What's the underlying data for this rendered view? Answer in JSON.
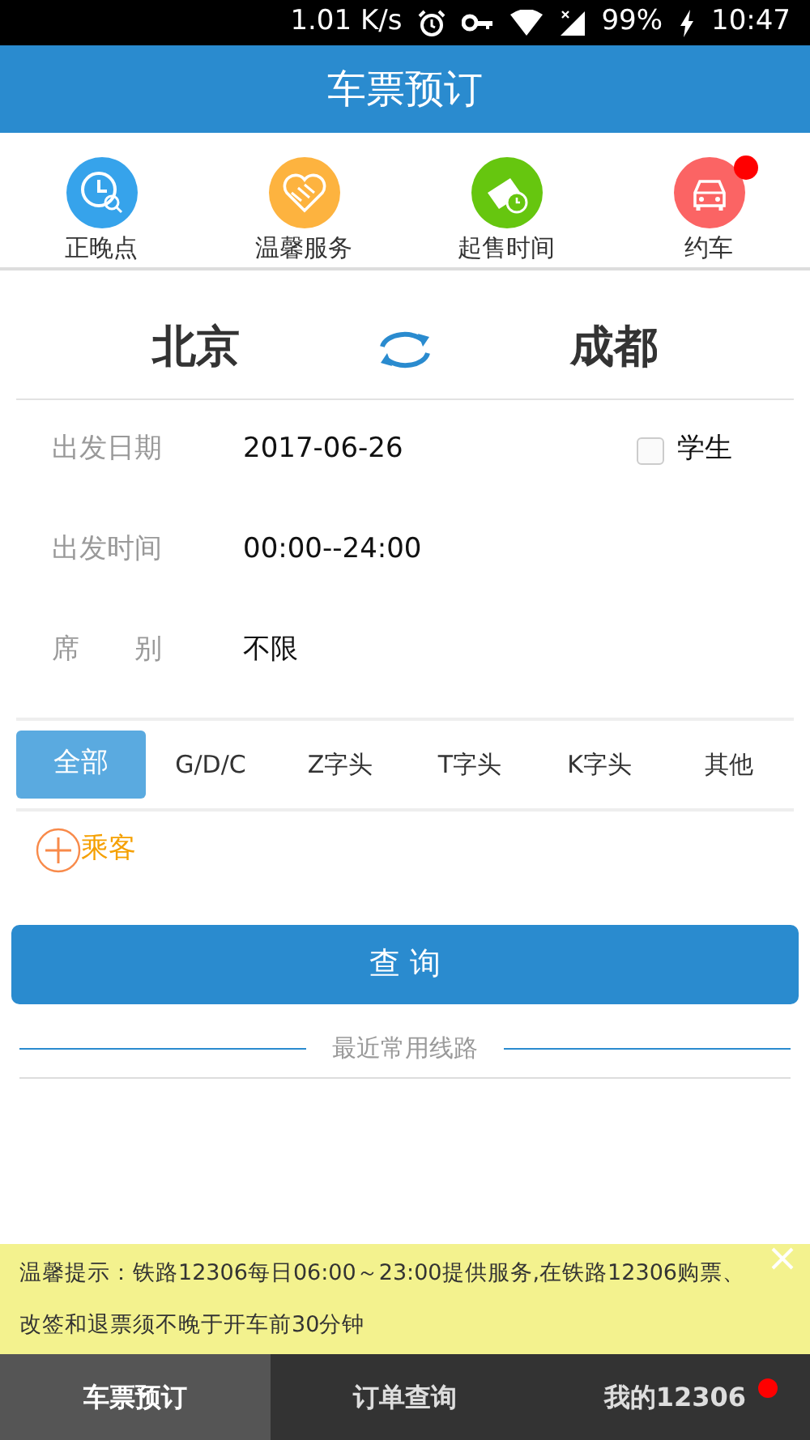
{
  "status_bar": {
    "speed": "1.01 K/s",
    "battery": "99%",
    "time": "10:47"
  },
  "header": {
    "title": "车票预订"
  },
  "shortcuts": [
    {
      "label": "正晚点",
      "kind": "clock",
      "color": "#36a3eb",
      "badge": false
    },
    {
      "label": "温馨服务",
      "kind": "handshake",
      "color": "#fdb33f",
      "badge": false
    },
    {
      "label": "起售时间",
      "kind": "ticket",
      "color": "#66c60f",
      "badge": false
    },
    {
      "label": "约车",
      "kind": "car",
      "color": "#fb6464",
      "badge": true
    }
  ],
  "route": {
    "from": "北京",
    "to": "成都"
  },
  "fields": [
    {
      "label": "出发日期",
      "value": "2017-06-26"
    },
    {
      "label": "出发时间",
      "value": "00:00--24:00"
    },
    {
      "label": "席　　别",
      "value": "不限"
    }
  ],
  "student": {
    "label": "学生",
    "checked": false
  },
  "train_types": [
    {
      "label": "全部",
      "selected": true
    },
    {
      "label": "G/D/C",
      "selected": false
    },
    {
      "label": "Z字头",
      "selected": false
    },
    {
      "label": "T字头",
      "selected": false
    },
    {
      "label": "K字头",
      "selected": false
    },
    {
      "label": "其他",
      "selected": false
    }
  ],
  "passenger": {
    "label": "乘客"
  },
  "search_button": "查 询",
  "recent": {
    "title": "最近常用线路"
  },
  "notice": {
    "text": "温馨提示：铁路12306每日06:00～23:00提供服务,在铁路12306购票、改签和退票须不晚于开车前30分钟"
  },
  "bottom_nav": [
    {
      "label": "车票预订",
      "selected": true,
      "badge": false
    },
    {
      "label": "订单查询",
      "selected": false,
      "badge": false
    },
    {
      "label": "我的12306",
      "selected": false,
      "badge": true
    }
  ]
}
